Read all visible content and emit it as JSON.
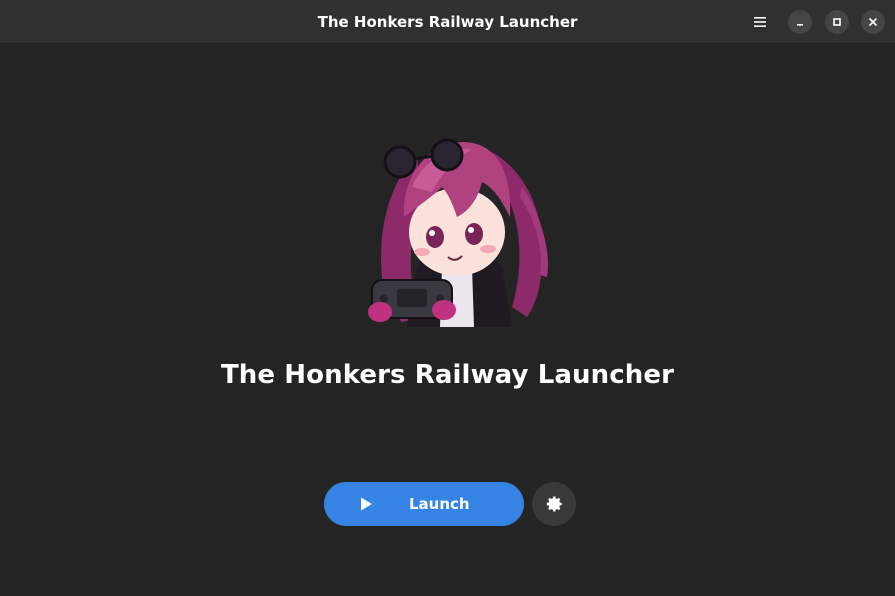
{
  "window": {
    "title": "The Honkers Railway Launcher"
  },
  "headerbar": {
    "menu_icon": "hamburger-menu-icon",
    "minimize_icon": "minimize-icon",
    "maximize_icon": "maximize-icon",
    "close_icon": "close-icon"
  },
  "main": {
    "app_title": "The Honkers Railway Launcher",
    "launch_label": "Launch",
    "launch_icon": "play-icon",
    "settings_icon": "gear-icon"
  },
  "colors": {
    "accent": "#3584e4",
    "background": "#242424",
    "headerbar": "#303030",
    "button_secondary": "#393939"
  }
}
